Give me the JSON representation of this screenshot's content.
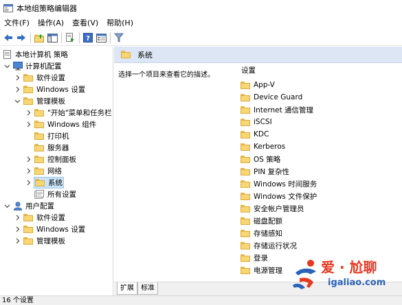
{
  "window": {
    "title": "本地组策略编辑器"
  },
  "menu": [
    "文件(F)",
    "操作(A)",
    "查看(V)",
    "帮助(H)"
  ],
  "toolbar": {
    "icons": [
      "back-arrow-icon",
      "forward-arrow-icon",
      "up-folder-icon",
      "show-tree-icon",
      "export-icon",
      "help-icon",
      "properties-icon",
      "filter-icon"
    ]
  },
  "tree": {
    "root": "本地计算机 策略",
    "computer_config": "计算机配置",
    "software_settings": "软件设置",
    "windows_settings": "Windows 设置",
    "admin_templates": "管理模板",
    "start_menu": "\"开始\"菜单和任务栏",
    "windows_components": "Windows 组件",
    "printers": "打印机",
    "server": "服务器",
    "control_panel": "控制面板",
    "network": "网络",
    "system": "系统",
    "all_settings": "所有设置",
    "user_config": "用户配置",
    "user_software_settings": "软件设置",
    "user_windows_settings": "Windows 设置",
    "user_admin_templates": "管理模板"
  },
  "right_pane": {
    "header_title": "系统",
    "description": "选择一个项目来查看它的描述。",
    "list_header": "设置",
    "items": [
      "App-V",
      "Device Guard",
      "Internet 通信管理",
      "iSCSI",
      "KDC",
      "Kerberos",
      "OS 策略",
      "PIN 复杂性",
      "Windows 时间服务",
      "Windows 文件保护",
      "安全帐户管理员",
      "磁盘配额",
      "存储感知",
      "存储运行状况",
      "登录",
      "电源管理"
    ]
  },
  "tabs": {
    "extended": "扩展",
    "standard": "标准"
  },
  "status": {
    "text": "16 个设置"
  },
  "watermark": {
    "text": "爱 · 尬聊",
    "url": "igaliao.com"
  },
  "colors": {
    "header_bg": "#dde6f4",
    "selected_bg": "#cce4f7",
    "folder_yellow": "#f6d774",
    "watermark_red": "#e8371f",
    "watermark_blue": "#2a63b7"
  }
}
